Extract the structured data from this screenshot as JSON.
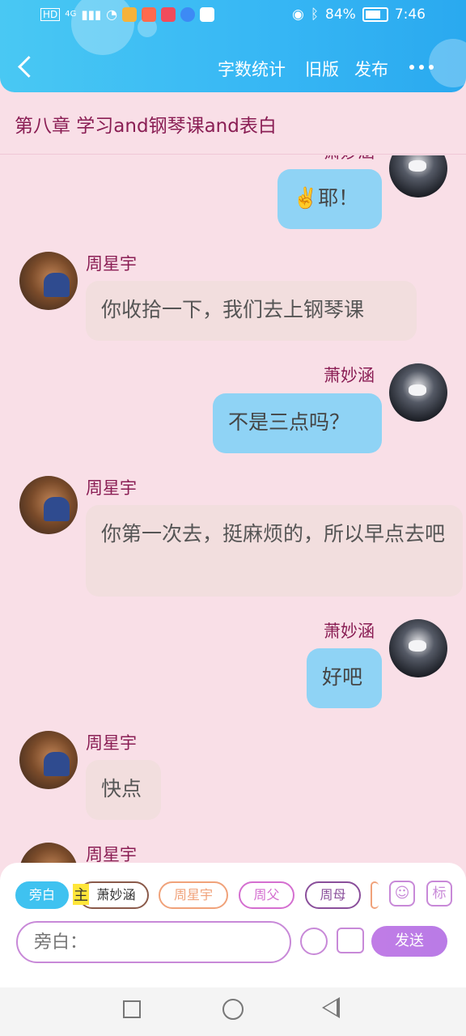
{
  "status_bar": {
    "left_icons": [
      "hd-icon",
      "4g-icon",
      "signal-icon",
      "wifi-icon",
      "app-icon",
      "weibo-icon",
      "app-icon-2",
      "browser-icon",
      "baidu-icon"
    ],
    "hd": "HD",
    "network": "4G",
    "battery_percent": "84%",
    "time": "7:46"
  },
  "toolbar": {
    "back_icon": "chevron-left-icon",
    "word_count": "字数统计",
    "old_version": "旧版",
    "publish": "发布",
    "more_icon": "more-icon"
  },
  "chapter_title": "第八章  学习and钢琴课and表白",
  "messages": [
    {
      "side": "right",
      "name": "萧妙涵",
      "text": "✌️耶！"
    },
    {
      "side": "left",
      "name": "周星宇",
      "text": "你收拾一下，我们去上钢琴课"
    },
    {
      "side": "right",
      "name": "萧妙涵",
      "text": "不是三点吗？"
    },
    {
      "side": "left",
      "name": "周星宇",
      "text": "你第一次去，挺麻烦的，所以早点去吧"
    },
    {
      "side": "right",
      "name": "萧妙涵",
      "text": "好吧"
    },
    {
      "side": "left",
      "name": "周星宇",
      "text": "快点"
    },
    {
      "side": "left",
      "name": "周星宇",
      "text": ""
    }
  ],
  "composer": {
    "roles": [
      "旁白",
      "萧妙涵",
      "周星宇",
      "周父",
      "周母"
    ],
    "main_tag": "主",
    "tag_icon_label": "标",
    "placeholder": "旁白：",
    "send": "发送"
  },
  "colors": {
    "header_start": "#49c8f3",
    "header_end": "#2aa9ef",
    "background": "#f9dfe7",
    "name_color": "#8a1e54",
    "left_bubble": "#f2dede",
    "right_bubble": "#8fd3f5",
    "accent_purple": "#c07ce6"
  }
}
